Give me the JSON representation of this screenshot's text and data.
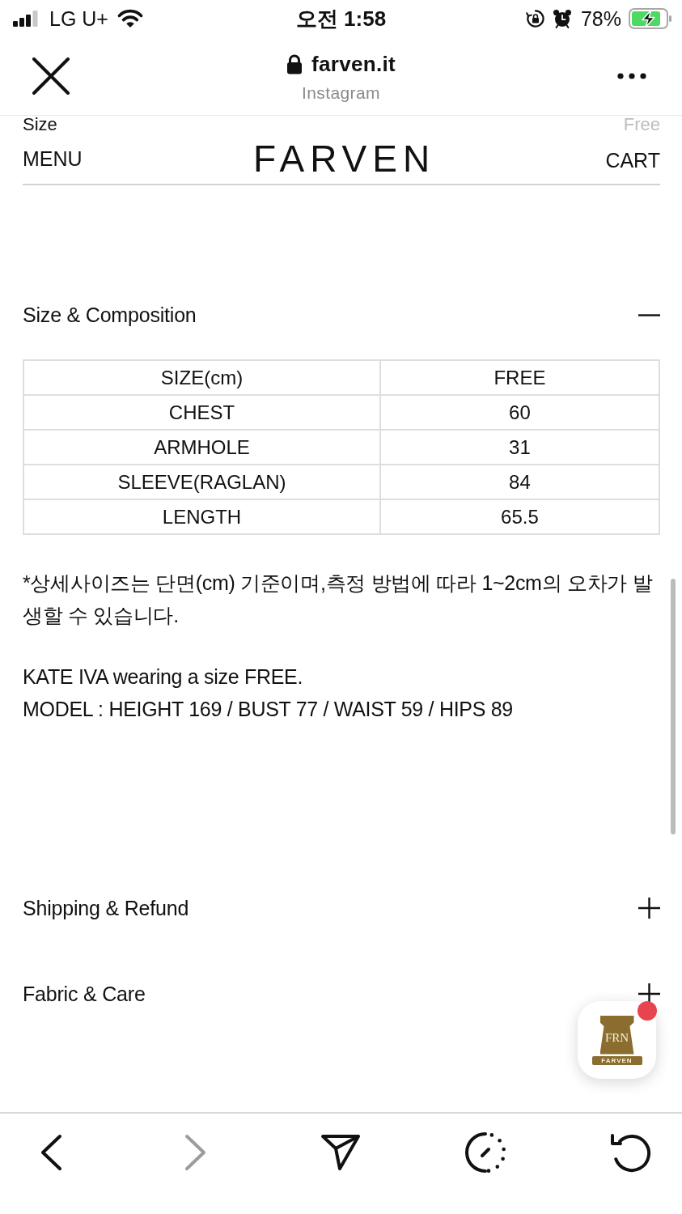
{
  "status_bar": {
    "carrier": "LG U+",
    "time": "오전 1:58",
    "battery": "78%"
  },
  "browser_header": {
    "domain": "farven.it",
    "source": "Instagram"
  },
  "cut_off_row": {
    "label": "Size",
    "value": "Free"
  },
  "site_header": {
    "menu": "MENU",
    "logo": "FARVEN",
    "cart": "CART"
  },
  "sections": [
    {
      "title": "Size & Composition",
      "expanded": true,
      "table": {
        "rows": [
          [
            "SIZE(cm)",
            "FREE"
          ],
          [
            "CHEST",
            "60"
          ],
          [
            "ARMHOLE",
            "31"
          ],
          [
            "SLEEVE(RAGLAN)",
            "84"
          ],
          [
            "LENGTH",
            "65.5"
          ]
        ]
      },
      "notes": [
        [
          "*상세사이즈는 단면(cm) 기준이며,측정 방법에 따라 1~2cm의 오차가 발생할 수 있습니다."
        ],
        [
          "KATE IVA wearing a size FREE.",
          "MODEL : HEIGHT 169 / BUST 77 / WAIST 59 / HIPS 89"
        ]
      ]
    },
    {
      "title": "Shipping & Refund",
      "expanded": false
    },
    {
      "title": "Fabric & Care",
      "expanded": false
    }
  ],
  "floating_badge": {
    "emblem": "FRN",
    "ribbon": "FARVEN",
    "has_notification": true
  },
  "toolbar": [
    {
      "kind": "back",
      "disabled": false
    },
    {
      "kind": "forward",
      "disabled": true
    },
    {
      "kind": "share",
      "disabled": false
    },
    {
      "kind": "timer",
      "disabled": false
    },
    {
      "kind": "reload",
      "disabled": false
    }
  ]
}
